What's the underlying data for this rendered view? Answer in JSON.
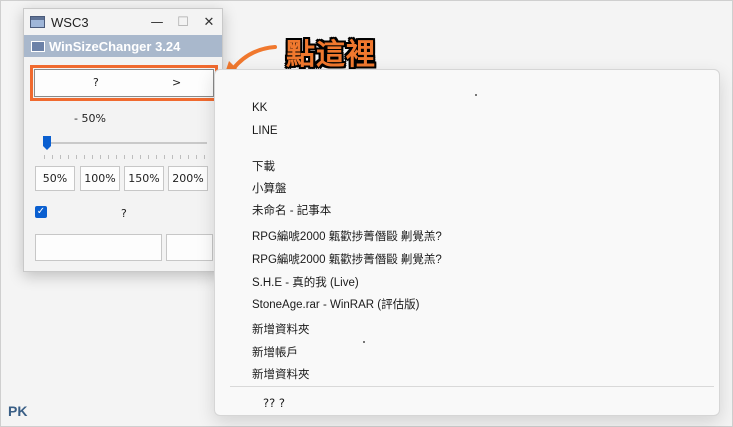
{
  "window": {
    "title": "WSC3",
    "minimize_glyph": "—",
    "maximize_glyph": "☐",
    "close_glyph": "✕",
    "banner": "WinSizeChanger 3.24"
  },
  "size_select": {
    "value": "?",
    "arrow": ">"
  },
  "scale_label": "- 50%",
  "slider_level_percent": 0,
  "percent_buttons": [
    "50%",
    "100%",
    "150%",
    "200%"
  ],
  "checkbox": {
    "checked": true,
    "label": "?"
  },
  "annotation": {
    "text": "點這裡",
    "color": "#f0782e"
  },
  "window_list": [
    "KK",
    "LINE",
    "下載",
    "小算盤",
    "未命名 - 記事本",
    "RPG編唬2000 甈歡捗菁僭毆 劓覺羔?",
    "RPG編唬2000 甈歡捗菁僭毆 劓覺羔?",
    "S.H.E - 真的我 (Live)",
    "StoneAge.rar - WinRAR (評估版)",
    "新增資料夾",
    "新增帳戶",
    "新增資料夾"
  ],
  "list_footer": "??  ?",
  "watermark": "PK",
  "accent_color": "#0a5fd0"
}
